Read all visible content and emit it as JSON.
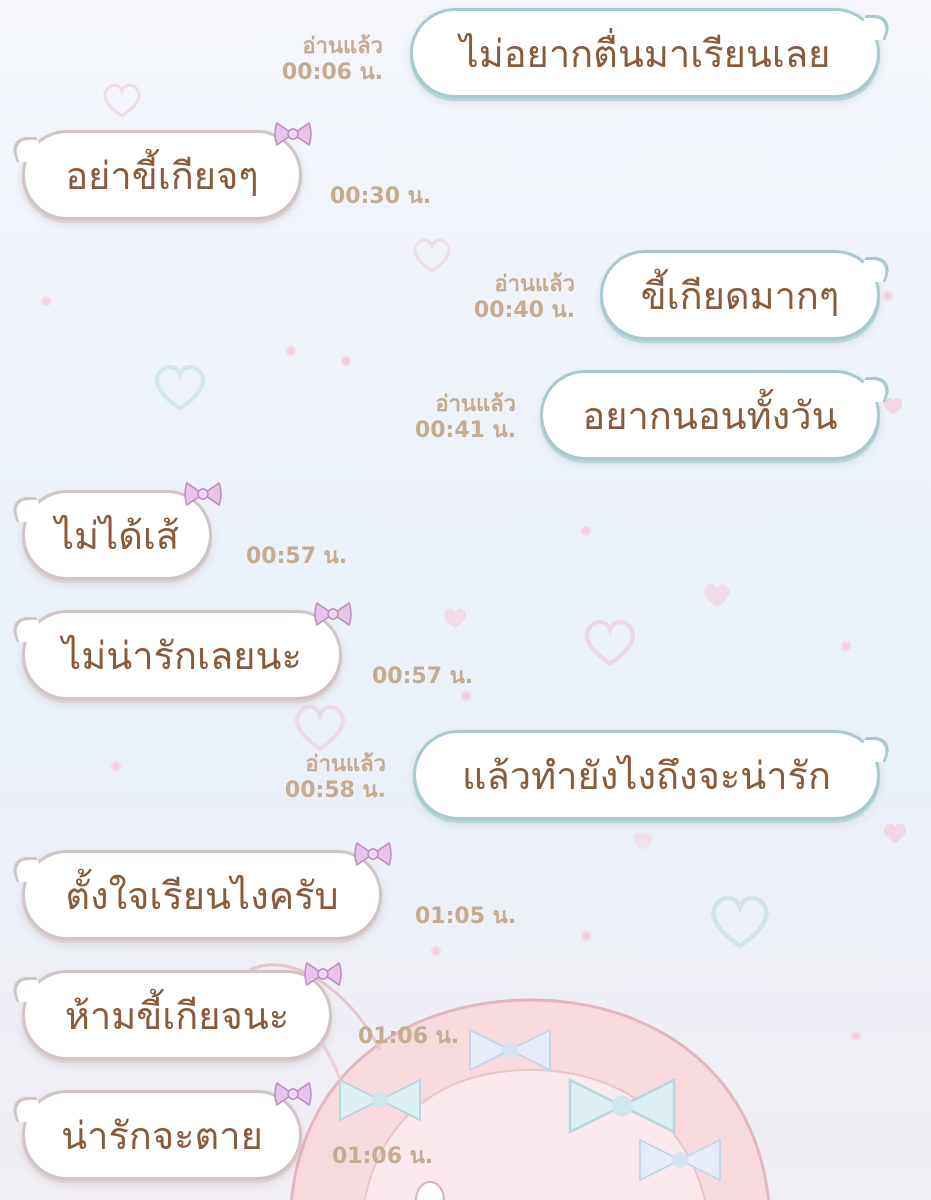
{
  "messages": [
    {
      "direction": "sent",
      "text": "ไม่อยากตื่นมาเรียนเลย",
      "read": "อ่านแล้ว",
      "time": "00:06 น."
    },
    {
      "direction": "received",
      "text": "อย่าขี้เกียจๆ",
      "time": "00:30 น."
    },
    {
      "direction": "sent",
      "text": "ขี้เกียดมากๆ",
      "read": "อ่านแล้ว",
      "time": "00:40 น."
    },
    {
      "direction": "sent",
      "text": "อยากนอนทั้งวัน",
      "read": "อ่านแล้ว",
      "time": "00:41 น."
    },
    {
      "direction": "received",
      "text": "ไม่ได้เส้",
      "time": "00:57 น."
    },
    {
      "direction": "received",
      "text": "ไม่น่ารักเลยนะ",
      "time": "00:57 น."
    },
    {
      "direction": "sent",
      "text": "แล้วทำยังไงถึงจะน่ารัก",
      "read": "อ่านแล้ว",
      "time": "00:58 น."
    },
    {
      "direction": "received",
      "text": "ตั้งใจเรียนไงครับ",
      "time": "01:05 น."
    },
    {
      "direction": "received",
      "text": "ห้ามขี้เกียจนะ",
      "time": "01:06 น."
    },
    {
      "direction": "received",
      "text": "น่ารักจะตาย",
      "time": "01:06 น."
    }
  ],
  "colors": {
    "bubble_text": "#8a5a3a",
    "meta_text": "#c4ab92",
    "sent_border": "#a9c9cf",
    "received_border": "#d2c4c6"
  },
  "icons": {
    "received_decoration": "bow-icon",
    "background_decoration": "heart-icon"
  }
}
